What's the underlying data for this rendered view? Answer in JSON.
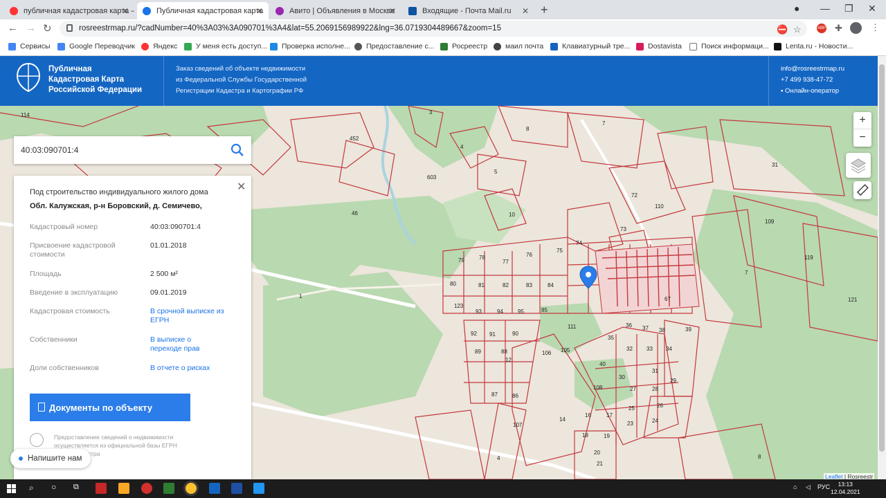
{
  "browser": {
    "tabs": [
      {
        "title": "публичная кадастровая карта –",
        "active": false
      },
      {
        "title": "Публичная кадастровая карта",
        "active": true
      },
      {
        "title": "Авито | Объявления в Москве",
        "active": false
      },
      {
        "title": "Входящие - Почта Mail.ru",
        "active": false
      }
    ],
    "url": "rosreestrmap.ru/?cadNumber=40%3A03%3A090701%3A4&lat=55.2069156989922&lng=36.0719304489667&zoom=15",
    "bookmarks": [
      "Сервисы",
      "Google Переводчик",
      "Яндекс",
      "У меня есть доступ...",
      "Проверка исполне...",
      "Предоставление с...",
      "Росреестр",
      "маил почта",
      "Клавиатурный тре...",
      "Dostavista",
      "Поиск информаци...",
      "Lenta.ru - Новости..."
    ]
  },
  "header": {
    "brand": [
      "Публичная",
      "Кадастровая Карта",
      "Российской Федерации"
    ],
    "info": [
      "Заказ сведений об объекте недвижимости",
      "из Федеральной Службы Государственной",
      "Регистрации Кадастра и Картографии РФ"
    ],
    "email": "info@rosreestrmap.ru",
    "phone": "+7 499 938-47-72",
    "operator": "Онлайн-оператор"
  },
  "search": {
    "value": "40:03:090701:4"
  },
  "panel": {
    "title": "Под строительство индивидуального жилого дома",
    "address": "Обл. Калужская, р-н Боровский, д. Семичево,",
    "rows": [
      {
        "label": "Кадастровый номер",
        "value": "40:03:090701:4"
      },
      {
        "label": "Присвоение кадастровой стоимости",
        "value": "01.01.2018"
      },
      {
        "label": "Площадь",
        "value": "2 500 м²"
      },
      {
        "label": "Введение в эксплуатацию",
        "value": "09.01.2019"
      }
    ],
    "links": [
      {
        "label": "Кадастровая стоимость",
        "value": "В срочной выписке из ЕГРН"
      },
      {
        "label": "Собственники",
        "value": "В выписке о переходе прав"
      },
      {
        "label": "Доли собственников",
        "value": "В отчете о рисках"
      }
    ],
    "doc_button": "Документы по объекту",
    "disclaimer": [
      "Предоставление сведений о недвижимости",
      "осуществляется из официальной базы ЕГРН",
      "ЕЦП Росреестра"
    ]
  },
  "chat": {
    "label": "Напишите нам"
  },
  "map": {
    "zoom_in": "+",
    "zoom_out": "−",
    "attribution_link": "Leaflet",
    "attribution_text": "| Rosreestr",
    "labels": [
      "114",
      "8",
      "3",
      "8",
      "7",
      "4",
      "452",
      "5",
      "603",
      "46",
      "10",
      "72",
      "73",
      "110",
      "31",
      "109",
      "119",
      "121",
      "7",
      "74",
      "1",
      "79",
      "78",
      "77",
      "76",
      "75",
      "80",
      "81",
      "82",
      "83",
      "84",
      "123",
      "93",
      "94",
      "95",
      "85",
      "111",
      "92",
      "91",
      "90",
      "36",
      "37",
      "38",
      "39",
      "35",
      "89",
      "88",
      "106",
      "105",
      "40",
      "32",
      "33",
      "34",
      "87",
      "86",
      "108",
      "30",
      "31",
      "29",
      "27",
      "28",
      "26",
      "107",
      "16",
      "17",
      "25",
      "24",
      "14",
      "18",
      "19",
      "23",
      "20",
      "21",
      "12",
      "4",
      "8"
    ],
    "colors": {
      "forest": "#b9d9b0",
      "land": "#ece6dc",
      "parcel_line": "#c4383e",
      "road": "#ffffff",
      "water": "#aad3df",
      "marker": "#2b7de9"
    }
  },
  "taskbar": {
    "tray": "РУС",
    "time": "13:13",
    "date": "12.04.2021"
  }
}
